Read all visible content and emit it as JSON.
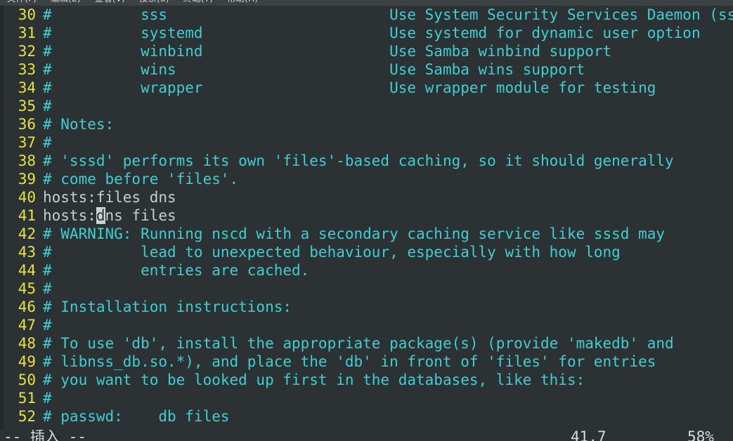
{
  "window": {
    "menubar": [
      {
        "label": "文件(F)",
        "name": "menu-file"
      },
      {
        "label": "编辑(E)",
        "name": "menu-edit"
      },
      {
        "label": "查看(V)",
        "name": "menu-view"
      },
      {
        "label": "搜索(S)",
        "name": "menu-search"
      },
      {
        "label": "终端(T)",
        "name": "menu-terminal"
      },
      {
        "label": "帮助(H)",
        "name": "menu-help"
      }
    ]
  },
  "colors": {
    "background": "#2c3233",
    "menubar_bg": "#3c4143",
    "line_number": "#e8e337",
    "comment": "#3cd0d4",
    "plain_text": "#c9cdcd",
    "cursor_bg": "#ced2d2",
    "status_text": "#d7dbdc"
  },
  "editor": {
    "lines": [
      {
        "num": "30",
        "kind": "comment",
        "text": "#          sss                         Use System Security Services Daemon (sssd)"
      },
      {
        "num": "31",
        "kind": "comment",
        "text": "#          systemd                     Use systemd for dynamic user option"
      },
      {
        "num": "32",
        "kind": "comment",
        "text": "#          winbind                     Use Samba winbind support"
      },
      {
        "num": "33",
        "kind": "comment",
        "text": "#          wins                        Use Samba wins support"
      },
      {
        "num": "34",
        "kind": "comment",
        "text": "#          wrapper                     Use wrapper module for testing"
      },
      {
        "num": "35",
        "kind": "comment",
        "text": "#"
      },
      {
        "num": "36",
        "kind": "comment",
        "text": "# Notes:"
      },
      {
        "num": "37",
        "kind": "comment",
        "text": "#"
      },
      {
        "num": "38",
        "kind": "comment",
        "text": "# 'sssd' performs its own 'files'-based caching, so it should generally"
      },
      {
        "num": "39",
        "kind": "comment",
        "text": "# come before 'files'."
      },
      {
        "num": "40",
        "kind": "plain",
        "text": "hosts:files dns"
      },
      {
        "num": "41",
        "kind": "plain-cursor",
        "text": "hosts:dns files",
        "cursor_col": 6
      },
      {
        "num": "42",
        "kind": "comment",
        "text": "# WARNING: Running nscd with a secondary caching service like sssd may"
      },
      {
        "num": "43",
        "kind": "comment",
        "text": "#          lead to unexpected behaviour, especially with how long"
      },
      {
        "num": "44",
        "kind": "comment",
        "text": "#          entries are cached."
      },
      {
        "num": "45",
        "kind": "comment",
        "text": "#"
      },
      {
        "num": "46",
        "kind": "comment",
        "text": "# Installation instructions:"
      },
      {
        "num": "47",
        "kind": "comment",
        "text": "#"
      },
      {
        "num": "48",
        "kind": "comment",
        "text": "# To use 'db', install the appropriate package(s) (provide 'makedb' and"
      },
      {
        "num": "49",
        "kind": "comment",
        "text": "# libnss_db.so.*), and place the 'db' in front of 'files' for entries"
      },
      {
        "num": "50",
        "kind": "comment",
        "text": "# you want to be looked up first in the databases, like this:"
      },
      {
        "num": "51",
        "kind": "comment",
        "text": "#"
      },
      {
        "num": "52",
        "kind": "comment",
        "text": "# passwd:    db files"
      }
    ]
  },
  "status": {
    "mode": "-- 插入 --",
    "position": "41,7",
    "percent": "58%"
  }
}
